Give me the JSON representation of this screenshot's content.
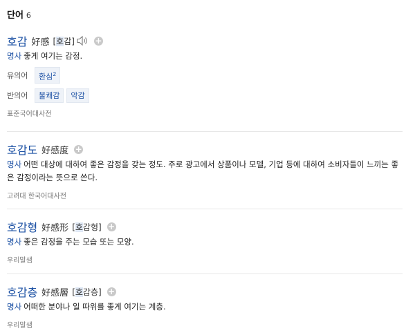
{
  "section": {
    "title": "단어",
    "count": "6"
  },
  "entries": [
    {
      "headword": "호감",
      "hanja": "好感",
      "pron_open": "[",
      "pron_hl": "호",
      "pron_rest": "감]",
      "pos": "명사",
      "definition": "좋게 여기는 감정.",
      "synonym_label": "유의어",
      "synonyms": [
        {
          "word": "환심",
          "sup": "2"
        }
      ],
      "antonym_label": "반의어",
      "antonyms": [
        {
          "word": "불쾌감"
        },
        {
          "word": "악감"
        }
      ],
      "source": "표준국어대사전"
    },
    {
      "headword": "호감도",
      "hanja": "好感度",
      "pos": "명사",
      "definition": "어떤 대상에 대하여 좋은 감정을 갖는 정도. 주로 광고에서 상품이나 모델, 기업 등에 대하여 소비자들이 느끼는 좋은 감정이라는 뜻으로 쓴다.",
      "source": "고려대 한국어대사전"
    },
    {
      "headword": "호감형",
      "hanja": "好感形",
      "pron_open": "[",
      "pron_hl": "호",
      "pron_rest": "감형]",
      "pos": "명사",
      "definition": "좋은 감정을 주는 모습 또는 모양.",
      "source": "우리말샘"
    },
    {
      "headword": "호감층",
      "hanja": "好感層",
      "pron_open": "[",
      "pron_hl": "호",
      "pron_rest": "감층]",
      "pos": "명사",
      "definition": "어떠한 분야나 일 따위를 좋게 여기는 계층.",
      "source": "우리말샘"
    }
  ]
}
